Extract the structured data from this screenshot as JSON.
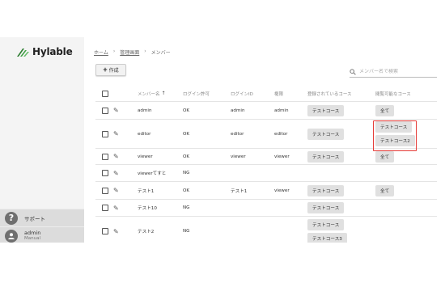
{
  "app": {
    "logo_text": "Hylable"
  },
  "sidebar": {
    "support_label": "サポート",
    "user_name": "admin",
    "user_role": "Manual"
  },
  "breadcrumb": {
    "items": [
      "ホーム",
      "管理画面",
      "メンバー"
    ]
  },
  "toolbar": {
    "create_label": "作成"
  },
  "search": {
    "placeholder": "メンバー名で検索"
  },
  "table": {
    "headers": [
      "メンバー名",
      "ログイン許可",
      "ログインID",
      "権限",
      "登録されているコース",
      "閲覧可能なコース"
    ],
    "rows": [
      {
        "name": "admin",
        "login": "OK",
        "id": "admin",
        "role": "admin",
        "courses": [
          "テストコース"
        ],
        "viewable": [
          "全て"
        ]
      },
      {
        "name": "editor",
        "login": "OK",
        "id": "editor",
        "role": "editor",
        "courses": [
          "テストコース"
        ],
        "viewable": [
          "テストコース",
          "テストコース2"
        ]
      },
      {
        "name": "viewer",
        "login": "OK",
        "id": "viewer",
        "role": "viewer",
        "courses": [
          "テストコース"
        ],
        "viewable": [
          "全て"
        ]
      },
      {
        "name": "viewerてすと",
        "login": "NG",
        "id": "",
        "role": "",
        "courses": [],
        "viewable": []
      },
      {
        "name": "テスト1",
        "login": "OK",
        "id": "テスト1",
        "role": "viewer",
        "courses": [
          "テストコース"
        ],
        "viewable": [
          "全て"
        ]
      },
      {
        "name": "テスト10",
        "login": "NG",
        "id": "",
        "role": "",
        "courses": [
          "テストコース"
        ],
        "viewable": []
      },
      {
        "name": "テスト2",
        "login": "NG",
        "id": "",
        "role": "",
        "courses": [
          "テストコース",
          "テストコース3"
        ],
        "viewable": []
      }
    ]
  },
  "colors": {
    "highlight": "#e53935",
    "sidebar_bg": "#f4f4f4",
    "chip_bg": "#e0e0e0"
  }
}
